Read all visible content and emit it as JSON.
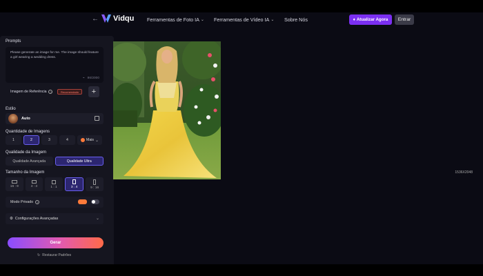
{
  "header": {
    "back_icon": "arrow-left-icon",
    "logo_text": "Vidqu",
    "nav": [
      "Ferramentas de Foto IA",
      "Ferramentas de Vídeo IA",
      "Sobre Nós"
    ],
    "upgrade_label": "Atualizar Agora",
    "login_label": "Entrar"
  },
  "panel": {
    "prompts_label": "Prompts",
    "prompt_text": "Please generate an image for me. The image should feature a girl wearing a wedding dress.",
    "char_count": "86/2000",
    "reference_label": "Imagem de Referência",
    "recommended_badge": "Recomendado",
    "style_label": "Estilo",
    "style_value": "Auto",
    "quantity_label": "Quantidade de Imagens",
    "quantity_options": [
      "1",
      "2",
      "3",
      "4"
    ],
    "quantity_selected": "2",
    "more_label": "Mais",
    "quality_label": "Qualidade da Imagem",
    "quality_options": [
      "Qualidade Avançada",
      "Qualidade Ultra"
    ],
    "quality_selected": "Qualidade Ultra",
    "size_label": "Tamanho da Imagem",
    "size_value": "1536X2048",
    "ratios": [
      "16 : 9",
      "4 : 3",
      "1 : 1",
      "3 : 4",
      "9 : 16"
    ],
    "ratio_selected": "3 : 4",
    "private_label": "Modo Privado",
    "private_enabled": false,
    "advanced_label": "Configurações Avançadas",
    "generate_label": "Gerar",
    "restore_label": "Restaurar Padrões"
  },
  "colors": {
    "accent": "#7b2ff2",
    "selected_border": "#6a5ff0",
    "generate_gradient": [
      "#8a4dff",
      "#e25ab0",
      "#ff6a48"
    ]
  }
}
